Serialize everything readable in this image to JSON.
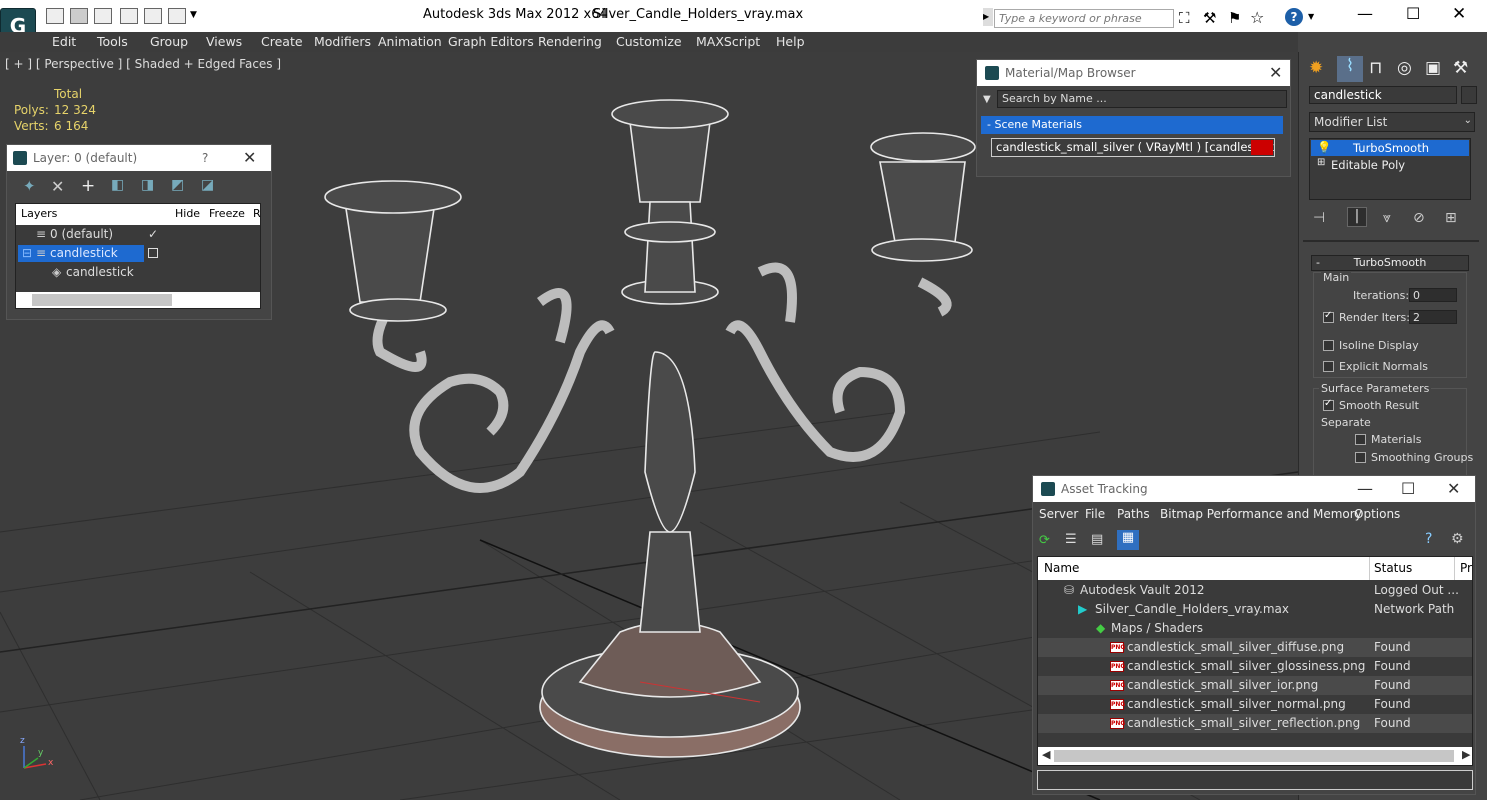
{
  "title": {
    "app": "Autodesk 3ds Max  2012 x64",
    "file": "Silver_Candle_Holders_vray.max",
    "search_placeholder": "Type a keyword or phrase"
  },
  "menu": [
    "Edit",
    "Tools",
    "Group",
    "Views",
    "Create",
    "Modifiers",
    "Animation",
    "Graph Editors",
    "Rendering",
    "Customize",
    "MAXScript",
    "Help"
  ],
  "viewport": {
    "label": "[ + ] [ Perspective ] [ Shaded + Edged Faces ]",
    "stats_header": "Total",
    "polys_label": "Polys:",
    "polys_value": "12 324",
    "verts_label": "Verts:",
    "verts_value": "6 164"
  },
  "layer_panel": {
    "title": "Layer: 0 (default)",
    "help": "?",
    "close": "✕",
    "cols": [
      "Layers",
      "Hide",
      "Freeze",
      "R"
    ],
    "rows": [
      "0 (default)",
      "candlestick",
      "candlestick"
    ]
  },
  "material_browser": {
    "title": "Material/Map Browser",
    "search_placeholder": "Search by Name ...",
    "group": "Scene Materials",
    "item": "candlestick_small_silver  ( VRayMtl ) [candlestick]"
  },
  "command_panel": {
    "object_name": "candlestick",
    "modifier_list": "Modifier List",
    "stack": [
      "TurboSmooth",
      "Editable Poly"
    ],
    "rollout": "TurboSmooth",
    "main_group": "Main",
    "iterations_label": "Iterations:",
    "iterations_value": "0",
    "render_iters_label": "Render Iters:",
    "render_iters_value": "2",
    "isoline": "Isoline Display",
    "explicit": "Explicit Normals",
    "surface_group": "Surface Parameters",
    "smooth_result": "Smooth Result",
    "separate": "Separate",
    "materials": "Materials",
    "smoothing_groups": "Smoothing Groups"
  },
  "asset_tracking": {
    "title": "Asset Tracking",
    "menu": [
      "Server",
      "File",
      "Paths",
      "Bitmap Performance and Memory",
      "Options"
    ],
    "cols": [
      "Name",
      "Status",
      "Pr"
    ],
    "rows": [
      {
        "name": "Autodesk Vault 2012",
        "status": "Logged Out ..."
      },
      {
        "name": "Silver_Candle_Holders_vray.max",
        "status": "Network Path"
      },
      {
        "name": "Maps / Shaders",
        "status": ""
      },
      {
        "name": "candlestick_small_silver_diffuse.png",
        "status": "Found"
      },
      {
        "name": "candlestick_small_silver_glossiness.png",
        "status": "Found"
      },
      {
        "name": "candlestick_small_silver_ior.png",
        "status": "Found"
      },
      {
        "name": "candlestick_small_silver_normal.png",
        "status": "Found"
      },
      {
        "name": "candlestick_small_silver_reflection.png",
        "status": "Found"
      }
    ]
  },
  "axis": {
    "x": "x",
    "y": "y",
    "z": "z"
  }
}
